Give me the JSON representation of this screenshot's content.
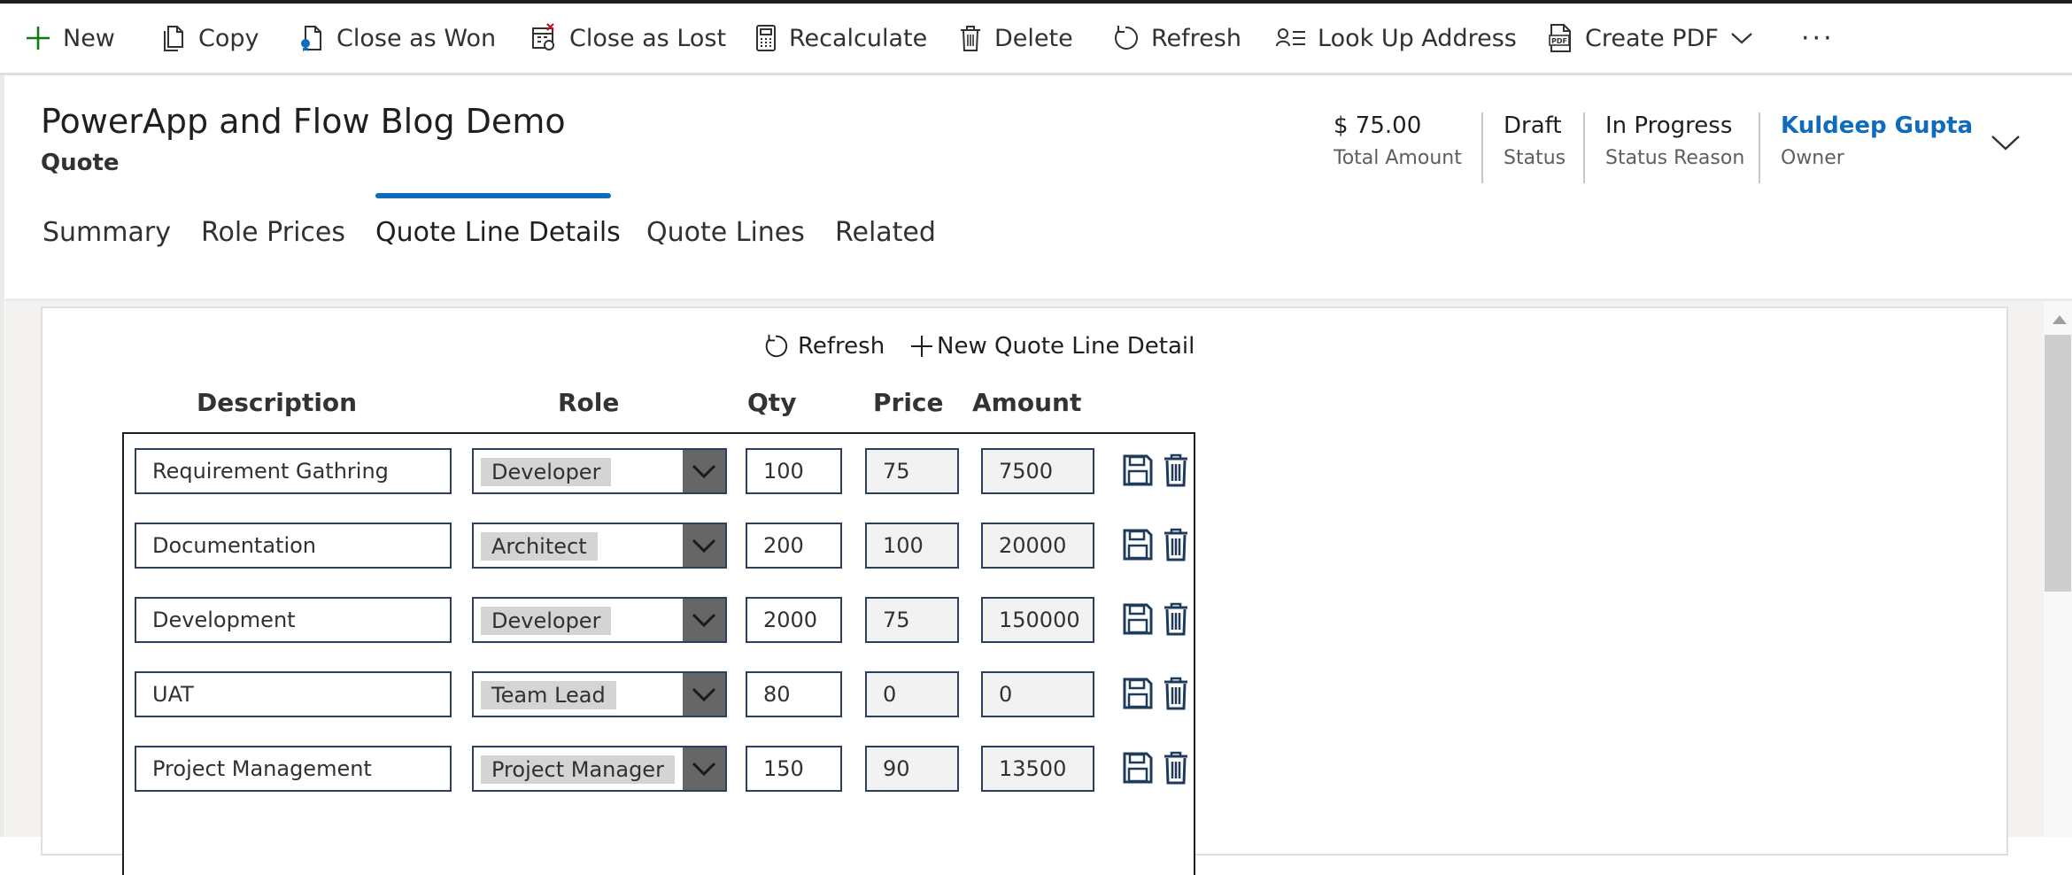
{
  "commands": [
    {
      "label": "New",
      "icon": "plus-icon"
    },
    {
      "label": "Copy",
      "icon": "copy-icon"
    },
    {
      "label": "Close as Won",
      "icon": "close-won-icon"
    },
    {
      "label": "Close as Lost",
      "icon": "close-lost-icon"
    },
    {
      "label": "Recalculate",
      "icon": "calculator-icon"
    },
    {
      "label": "Delete",
      "icon": "trash-icon"
    },
    {
      "label": "Refresh",
      "icon": "refresh-icon"
    },
    {
      "label": "Look Up Address",
      "icon": "contact-card-icon"
    },
    {
      "label": "Create PDF",
      "icon": "pdf-icon"
    }
  ],
  "more_label": "···",
  "record": {
    "title": "PowerApp and Flow Blog Demo",
    "type": "Quote"
  },
  "header_fields": [
    {
      "value": "$ 75.00",
      "label": "Total Amount"
    },
    {
      "value": "Draft",
      "label": "Status"
    },
    {
      "value": "In Progress",
      "label": "Status Reason"
    },
    {
      "value": "Kuldeep Gupta",
      "label": "Owner"
    }
  ],
  "tabs": [
    {
      "label": "Summary",
      "active": false
    },
    {
      "label": "Role Prices",
      "active": false
    },
    {
      "label": "Quote Line Details",
      "active": true
    },
    {
      "label": "Quote Lines",
      "active": false
    },
    {
      "label": "Related",
      "active": false
    }
  ],
  "grid_commands": {
    "refresh": "Refresh",
    "new_detail": "New Quote Line Detail"
  },
  "columns": {
    "description": "Description",
    "role": "Role",
    "qty": "Qty",
    "price": "Price",
    "amount": "Amount"
  },
  "rows": [
    {
      "description": "Requirement Gathring",
      "role": "Developer",
      "qty": "100",
      "price": "75",
      "amount": "7500"
    },
    {
      "description": "Documentation",
      "role": "Architect",
      "qty": "200",
      "price": "100",
      "amount": "20000"
    },
    {
      "description": "Development",
      "role": "Developer",
      "qty": "2000",
      "price": "75",
      "amount": "150000"
    },
    {
      "description": "UAT",
      "role": "Team Lead",
      "qty": "80",
      "price": "0",
      "amount": "0"
    },
    {
      "description": "Project Management",
      "role": "Project Manager",
      "qty": "150",
      "price": "90",
      "amount": "13500"
    }
  ],
  "colors": {
    "accent": "#0f6cbd",
    "field_border": "#2e3f5c",
    "dropdown_button": "#666666",
    "command_icon_green": "#107c10"
  }
}
